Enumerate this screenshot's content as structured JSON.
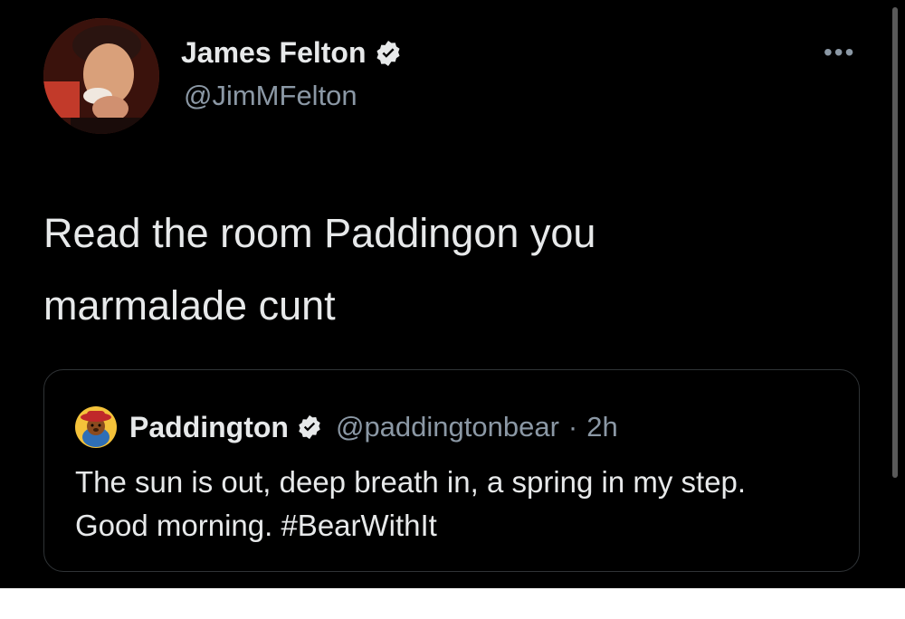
{
  "author": {
    "display_name": "James Felton",
    "handle": "@JimMFelton",
    "verified_icon": "verified-badge-icon",
    "avatar_icon": "profile-photo"
  },
  "more_icon": "more-options-icon",
  "tweet": {
    "text": "Read the room Paddingon you\nmarmalade cunt"
  },
  "quote": {
    "display_name": "Paddington",
    "handle": "@paddingtonbear",
    "separator": "·",
    "time": "2h",
    "text": "The sun is out, deep breath in, a spring in my step. Good morning.  #BearWithIt"
  },
  "colors": {
    "background": "#000000",
    "primary_text": "#e7e9ea",
    "secondary_text": "#8b98a5",
    "border": "#2f3336"
  }
}
